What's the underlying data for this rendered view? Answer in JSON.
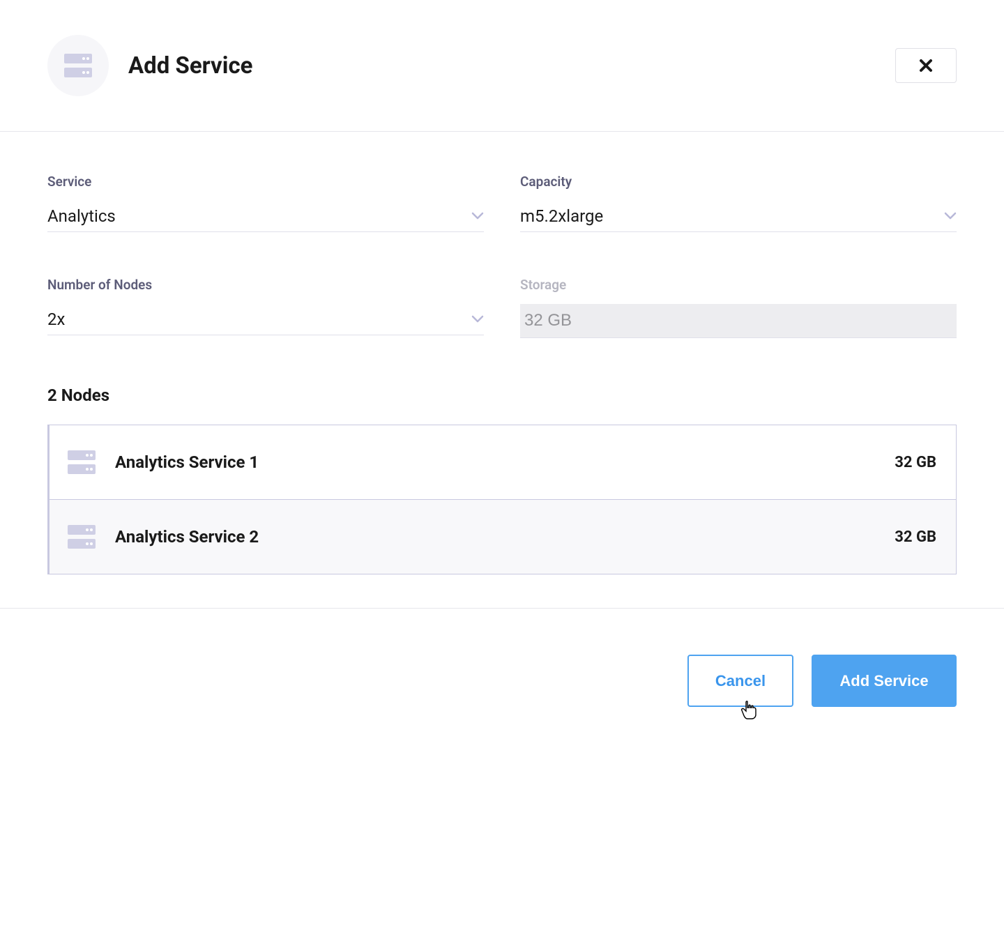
{
  "header": {
    "title": "Add Service"
  },
  "fields": {
    "service": {
      "label": "Service",
      "value": "Analytics"
    },
    "capacity": {
      "label": "Capacity",
      "value": "m5.2xlarge"
    },
    "nodes": {
      "label": "Number of Nodes",
      "value": "2x"
    },
    "storage": {
      "label": "Storage",
      "value": "32 GB"
    }
  },
  "nodes": {
    "header": "2 Nodes",
    "items": [
      {
        "name": "Analytics Service 1",
        "size": "32 GB"
      },
      {
        "name": "Analytics Service 2",
        "size": "32 GB"
      }
    ]
  },
  "footer": {
    "cancel": "Cancel",
    "submit": "Add Service"
  }
}
